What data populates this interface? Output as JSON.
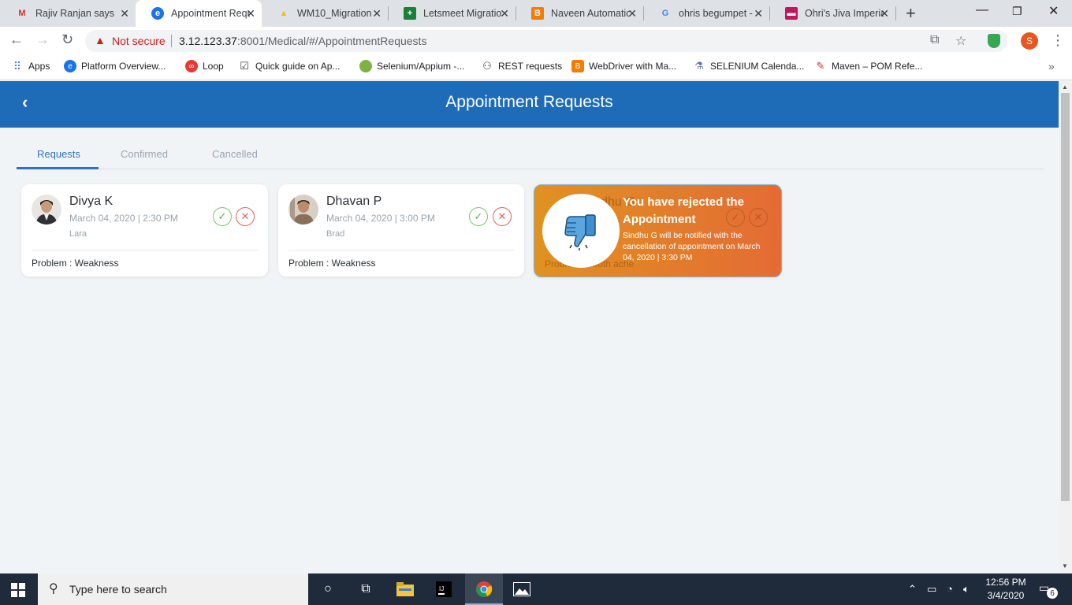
{
  "browser": {
    "tabs": [
      {
        "title": "Rajiv Ranjan says...",
        "icon": "gmail-icon",
        "color": "#d93025",
        "glyph": "M"
      },
      {
        "title": "Appointment Requ",
        "icon": "edge-app-icon",
        "color": "#1a73e8",
        "glyph": "e"
      },
      {
        "title": "WM10_Migration",
        "icon": "google-drive-icon",
        "color": "#fbbc04",
        "glyph": "▲"
      },
      {
        "title": "Letsmeet Migratio",
        "icon": "google-sheets-icon",
        "color": "#188038",
        "glyph": "+"
      },
      {
        "title": "Naveen Automatio",
        "icon": "blogger-icon",
        "color": "#f57c00",
        "glyph": "B"
      },
      {
        "title": "ohris begumpet -",
        "icon": "google-icon",
        "color": "#4285f4",
        "glyph": "G"
      },
      {
        "title": "Ohri's Jiva Imperia",
        "icon": "restaurant-icon",
        "color": "#c2185b",
        "glyph": "▬"
      }
    ],
    "security_label": "Not secure",
    "url_host": "3.12.123.37",
    "url_rest": ":8001/Medical/#/AppointmentRequests",
    "profile_initial": "S",
    "bookmarks": [
      {
        "label": "Apps",
        "icon": "apps-grid-icon",
        "color": "#4285f4"
      },
      {
        "label": "Platform Overview...",
        "icon": "platform-icon",
        "color": "#1a73e8"
      },
      {
        "label": "Loop",
        "icon": "loop-icon",
        "color": "#e53935"
      },
      {
        "label": "Quick guide on Ap...",
        "icon": "checkbox-icon",
        "color": "#444444"
      },
      {
        "label": "Selenium/Appium -...",
        "icon": "leaf-icon",
        "color": "#7cb342"
      },
      {
        "label": "REST requests",
        "icon": "network-icon",
        "color": "#333333"
      },
      {
        "label": "WebDriver with Ma...",
        "icon": "blogger-icon",
        "color": "#f57c00"
      },
      {
        "label": "SELENIUM Calenda...",
        "icon": "selenium-icon",
        "color": "#5c6bc0"
      },
      {
        "label": "Maven – POM Refe...",
        "icon": "feather-icon",
        "color": "#c62828"
      }
    ]
  },
  "app": {
    "title": "Appointment Requests",
    "tabs": [
      {
        "label": "Requests",
        "active": true
      },
      {
        "label": "Confirmed",
        "active": false
      },
      {
        "label": "Cancelled",
        "active": false
      }
    ],
    "cards": [
      {
        "name": "Divya K",
        "datetime": "March 04, 2020 | 2:30 PM",
        "contact": "Lara",
        "problem": "Problem : Weakness"
      },
      {
        "name": "Dhavan P",
        "datetime": "March 04, 2020 | 3:00 PM",
        "contact": "Brad",
        "problem": "Problem : Weakness"
      },
      {
        "name": "Sindhu G",
        "problem": "Problem : Tooth ache"
      }
    ],
    "rejection": {
      "title": "You have rejected the Appointment",
      "message": "Sindhu G will be notified with the cancellation of appointment on March 04, 2020 | 3:30 PM"
    },
    "colors": {
      "header": "#1e6bb8",
      "accept": "#5cb04a",
      "reject": "#e5625c",
      "rejected_overlay": "#e27d2c"
    }
  },
  "taskbar": {
    "search_placeholder": "Type here to search",
    "time": "12:56 PM",
    "date": "3/4/2020",
    "notifications": "6"
  }
}
